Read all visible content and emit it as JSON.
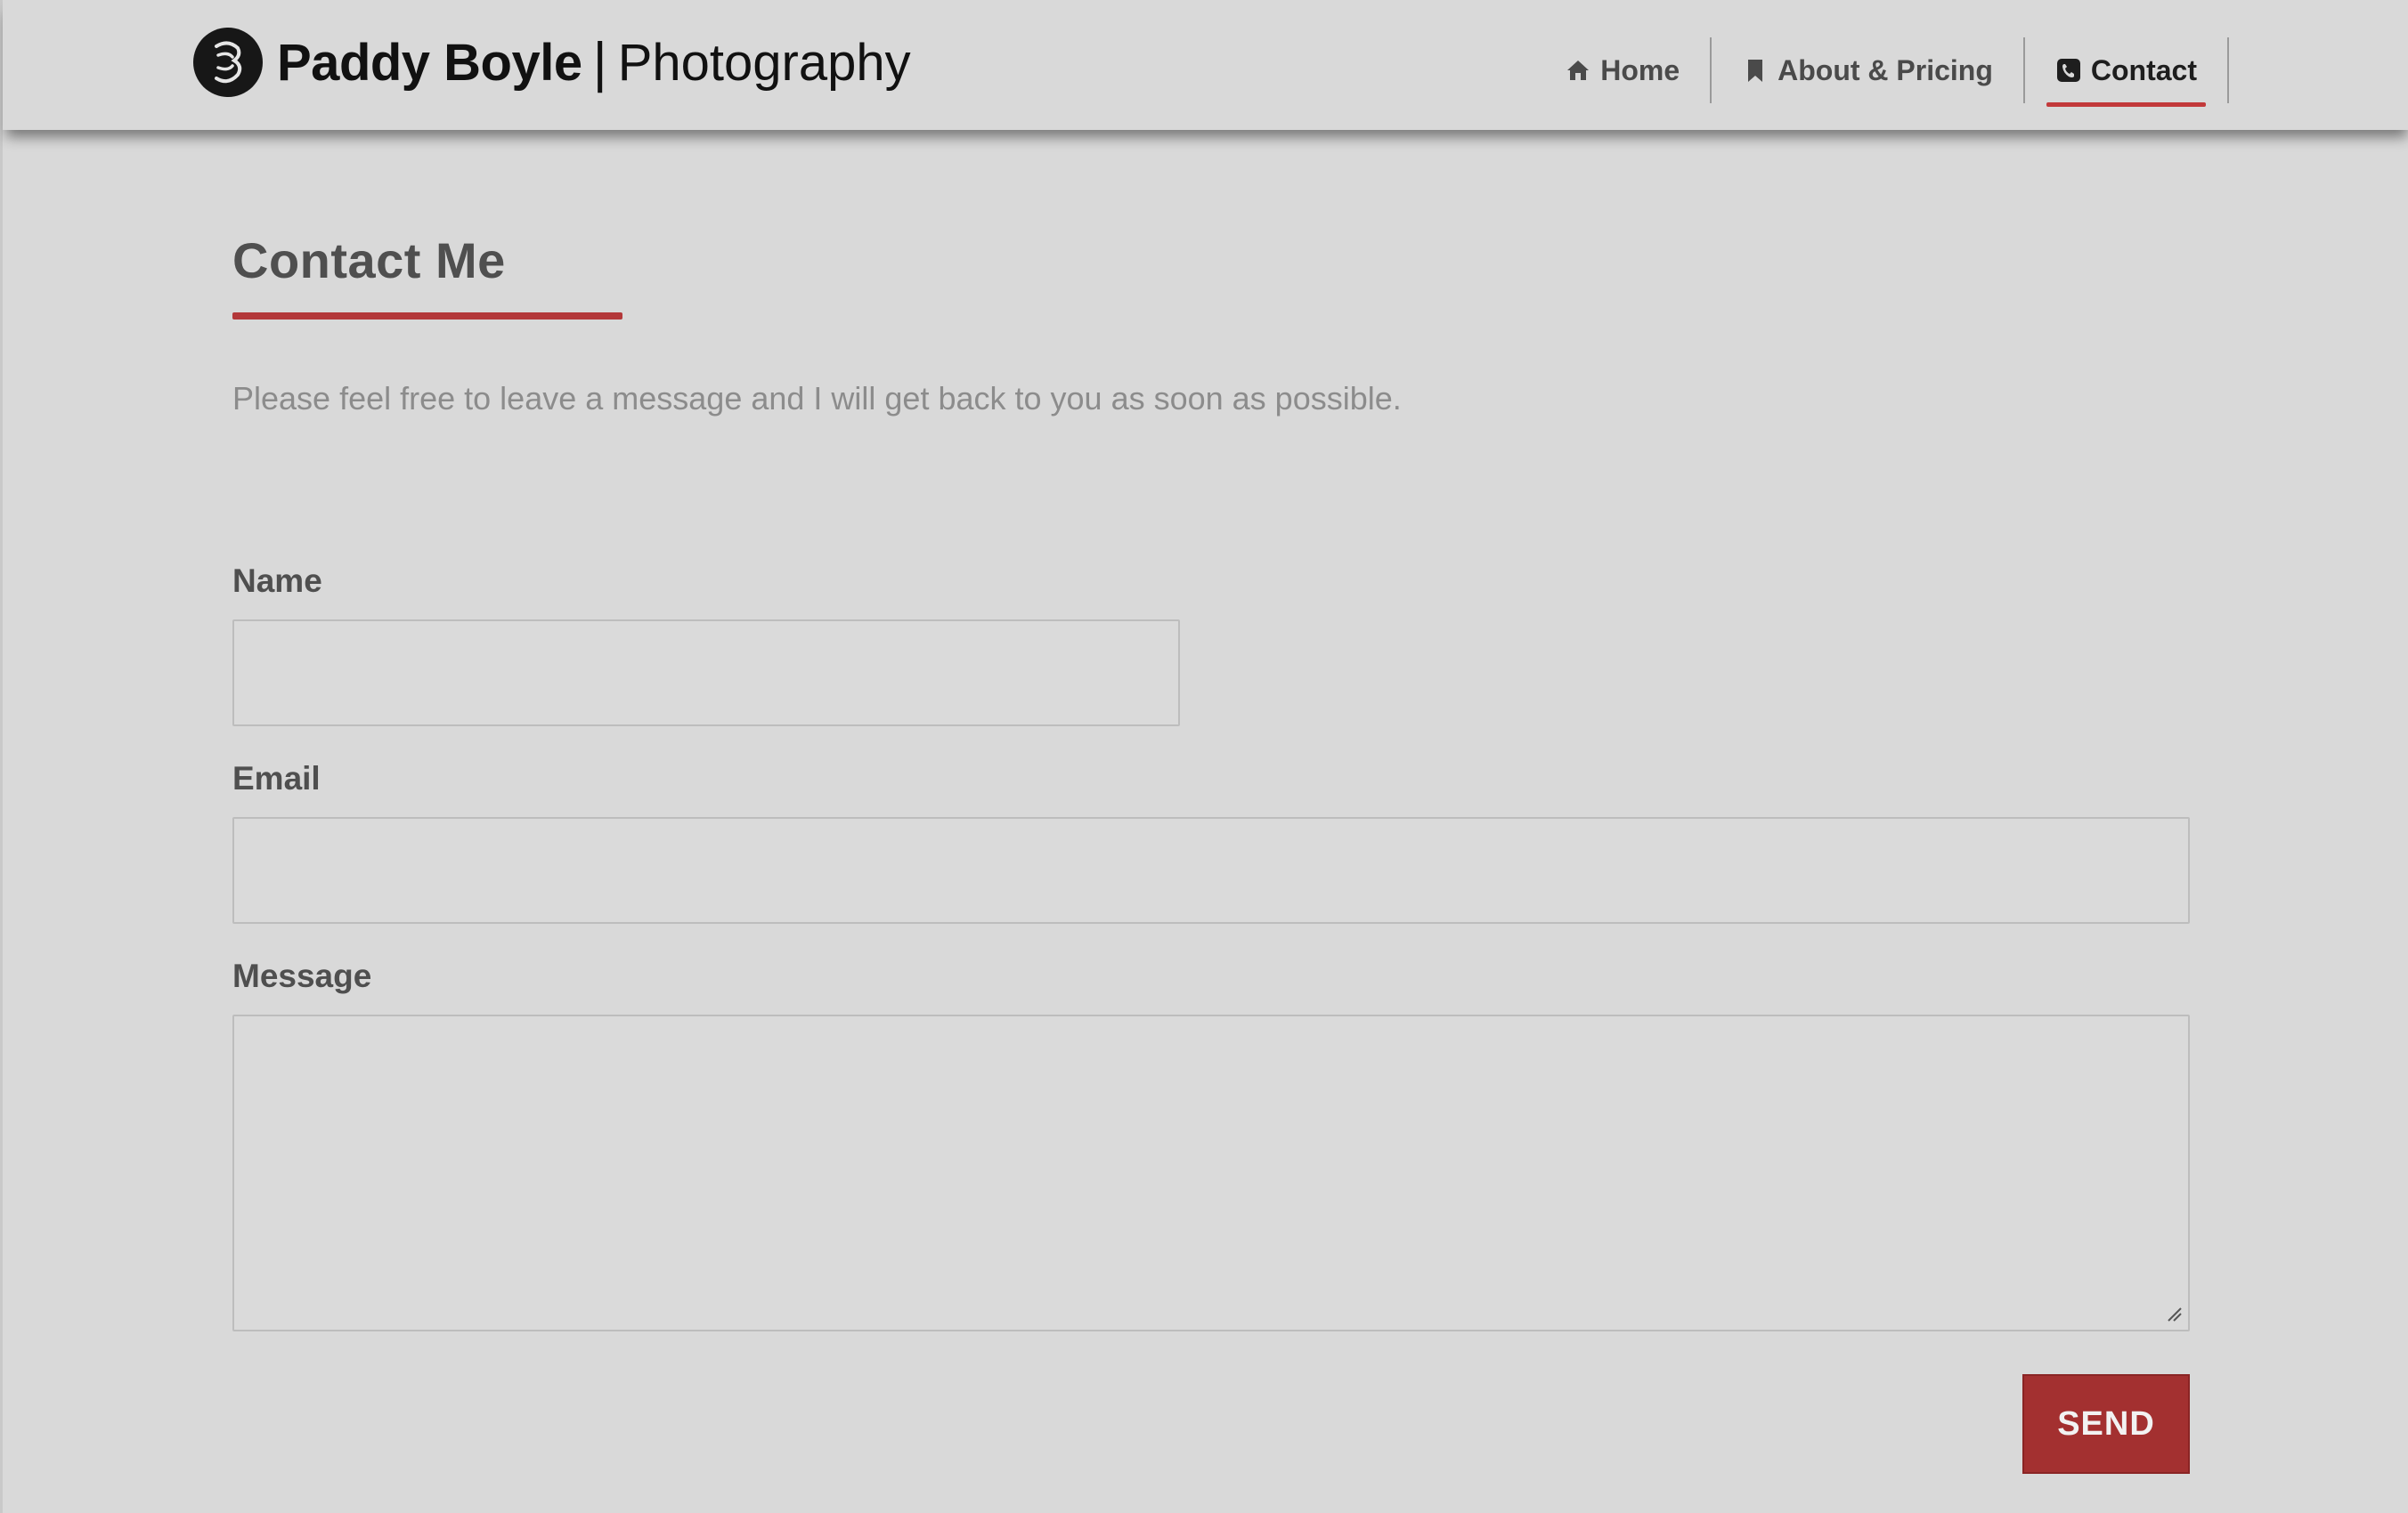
{
  "brand": {
    "name": "Paddy Boyle",
    "separator": "|",
    "subtitle": "Photography",
    "logo_icon": "camera-monogram-icon"
  },
  "nav": {
    "items": [
      {
        "label": "Home",
        "icon": "home-icon",
        "active": false
      },
      {
        "label": "About & Pricing",
        "icon": "bookmark-icon",
        "active": false
      },
      {
        "label": "Contact",
        "icon": "phone-icon",
        "active": true
      }
    ]
  },
  "contact": {
    "title": "Contact Me",
    "intro": "Please feel free to leave a message and I will get back to you as soon as possible.",
    "fields": {
      "name_label": "Name",
      "name_value": "",
      "email_label": "Email",
      "email_value": "",
      "message_label": "Message",
      "message_value": ""
    },
    "send_label": "SEND"
  },
  "colors": {
    "accent": "#b3383a",
    "button": "#a33030",
    "background": "#d9d9d9",
    "text": "#4f4f4f"
  }
}
